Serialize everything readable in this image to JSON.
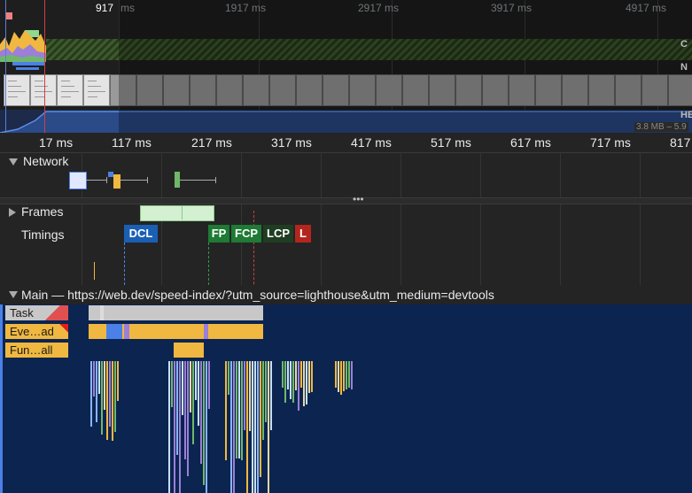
{
  "overview": {
    "tick_labels": [
      "917",
      "1917 ms",
      "2917 ms",
      "3917 ms",
      "4917 ms"
    ],
    "tick_suffix_first": "ms",
    "side_letters": [
      "C",
      "N",
      "HE"
    ],
    "heap_range": "3.8 MB – 5.9"
  },
  "ruler": {
    "labels": [
      "17 ms",
      "117 ms",
      "217 ms",
      "317 ms",
      "417 ms",
      "517 ms",
      "617 ms",
      "717 ms",
      "817"
    ]
  },
  "tracks": {
    "network": "Network",
    "frames": "Frames",
    "timings": "Timings",
    "main": "Main — https://web.dev/speed-index/?utm_source=lighthouse&utm_medium=devtools"
  },
  "timing_markers": [
    {
      "label": "DCL",
      "color": "#1a5fb4"
    },
    {
      "label": "FP",
      "color": "#1e7a34"
    },
    {
      "label": "FCP",
      "color": "#1e7a34"
    },
    {
      "label": "LCP",
      "color": "#1f3d22"
    },
    {
      "label": "L",
      "color": "#b3261e"
    }
  ],
  "flame_labels": {
    "task": "Task",
    "event": "Eve…ad",
    "function": "Fun…all"
  },
  "colors": {
    "task": "#c8c8c8",
    "scripting": "#f0b840",
    "rendering": "#9b7fd8",
    "painting": "#6fb86a",
    "loading": "#4a80e8",
    "flame_bg": "#0c2450",
    "frame": "#d3f0d0"
  },
  "divider_grip": "•••"
}
